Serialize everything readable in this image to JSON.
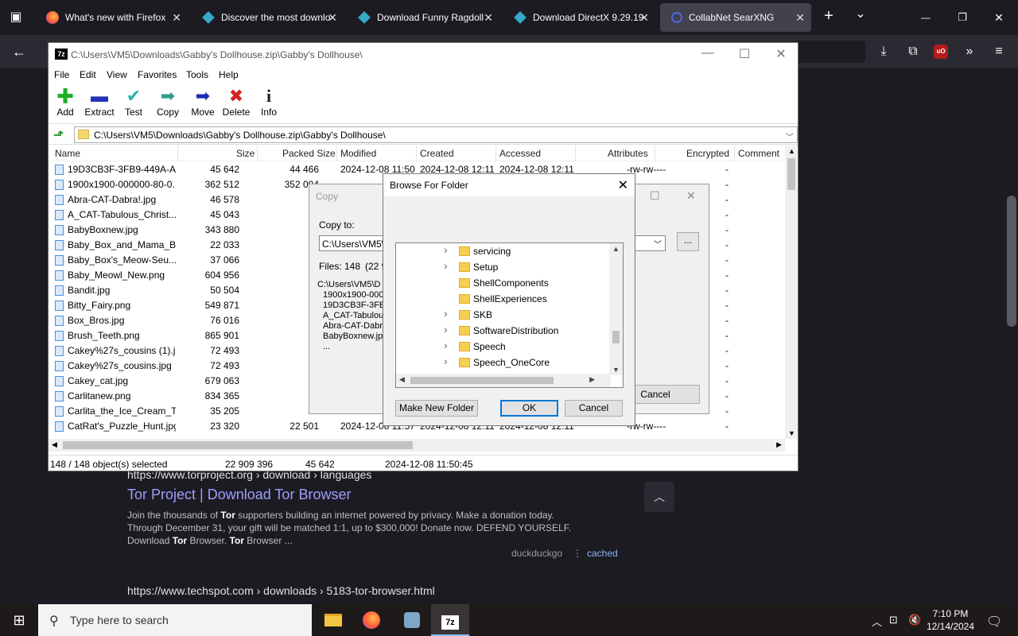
{
  "browser": {
    "tabs": [
      {
        "label": "What's new with Firefox",
        "icon": "firefox-icon"
      },
      {
        "label": "Discover the most downlo",
        "icon": "download-site-icon"
      },
      {
        "label": "Download Funny Ragdoll",
        "icon": "download-site-icon"
      },
      {
        "label": "Download DirectX 9.29.19",
        "icon": "download-site-icon"
      },
      {
        "label": "CollabNet SearXNG",
        "icon": "searxng-icon",
        "active": true
      }
    ],
    "new_tab": "+",
    "tab_list": "⌄",
    "minimize": "—",
    "restore": "❐",
    "close": "✕",
    "back": "←"
  },
  "search_results": [
    {
      "url": "https://www.torproject.org › download › languages",
      "title": "Tor Project | Download Tor Browser",
      "snippet_l1_a": "Join the thousands of ",
      "snippet_l1_b": "Tor",
      "snippet_l1_c": " supporters building an internet powered by privacy. Make a donation today.",
      "snippet_l2": "Through December 31, your gift will be matched 1:1, up to $300,000! Donate now. DEFEND YOURSELF.",
      "snippet_l3_a": "Download ",
      "snippet_l3_b": "Tor",
      "snippet_l3_c": " Browser. ",
      "snippet_l3_d": "Tor",
      "snippet_l3_e": " Browser ...",
      "engine": "duckduckgo",
      "sep": "⋮",
      "cached": "cached"
    },
    {
      "url": "https://www.techspot.com › downloads › 5183-tor-browser.html"
    }
  ],
  "sevenzip": {
    "title": "C:\\Users\\VM5\\Downloads\\Gabby's Dollhouse.zip\\Gabby's Dollhouse\\",
    "app_icon": "7z",
    "menu": [
      "File",
      "Edit",
      "View",
      "Favorites",
      "Tools",
      "Help"
    ],
    "toolbar": [
      "Add",
      "Extract",
      "Test",
      "Copy",
      "Move",
      "Delete",
      "Info"
    ],
    "address": "C:\\Users\\VM5\\Downloads\\Gabby's Dollhouse.zip\\Gabby's Dollhouse\\",
    "columns": [
      "Name",
      "Size",
      "Packed Size",
      "Modified",
      "Created",
      "Accessed",
      "Attributes",
      "Encrypted",
      "Comment"
    ],
    "rows": [
      {
        "name": "19D3CB3F-3FB9-449A-A...",
        "size": "45 642",
        "packed": "44 466",
        "modified": "2024-12-08 11:50",
        "created": "2024-12-08 12:11",
        "accessed": "2024-12-08 12:11",
        "attr": "-rw-rw----",
        "enc": "-"
      },
      {
        "name": "1900x1900-000000-80-0...",
        "size": "362 512",
        "packed": "352 004",
        "modified": "",
        "created": "",
        "accessed": "",
        "attr": "",
        "enc": "-"
      },
      {
        "name": "Abra-CAT-Dabra!.jpg",
        "size": "46 578",
        "packed": "4",
        "modified": "",
        "created": "",
        "accessed": "",
        "attr": "",
        "enc": "-"
      },
      {
        "name": "A_CAT-Tabulous_Christ...",
        "size": "45 043",
        "packed": "4",
        "modified": "",
        "created": "",
        "accessed": "",
        "attr": "",
        "enc": "-"
      },
      {
        "name": "BabyBoxnew.jpg",
        "size": "343 880",
        "packed": "33",
        "modified": "",
        "created": "",
        "accessed": "",
        "attr": "",
        "enc": "-"
      },
      {
        "name": "Baby_Box_and_Mama_B...",
        "size": "22 033",
        "packed": "2",
        "modified": "",
        "created": "",
        "accessed": "",
        "attr": "",
        "enc": "-"
      },
      {
        "name": "Baby_Box's_Meow-Seu...",
        "size": "37 066",
        "packed": "3",
        "modified": "",
        "created": "",
        "accessed": "",
        "attr": "",
        "enc": "-"
      },
      {
        "name": "Baby_Meowl_New.png",
        "size": "604 956",
        "packed": "60",
        "modified": "",
        "created": "",
        "accessed": "",
        "attr": "",
        "enc": "-"
      },
      {
        "name": "Bandit.jpg",
        "size": "50 504",
        "packed": "5",
        "modified": "",
        "created": "",
        "accessed": "",
        "attr": "",
        "enc": "-"
      },
      {
        "name": "Bitty_Fairy.png",
        "size": "549 871",
        "packed": "54",
        "modified": "",
        "created": "",
        "accessed": "",
        "attr": "",
        "enc": "-"
      },
      {
        "name": "Box_Bros.jpg",
        "size": "76 016",
        "packed": "7",
        "modified": "",
        "created": "",
        "accessed": "",
        "attr": "",
        "enc": "-"
      },
      {
        "name": "Brush_Teeth.png",
        "size": "865 901",
        "packed": "86",
        "modified": "",
        "created": "",
        "accessed": "",
        "attr": "",
        "enc": "-"
      },
      {
        "name": "Cakey%27s_cousins (1).j...",
        "size": "72 493",
        "packed": "7",
        "modified": "",
        "created": "",
        "accessed": "",
        "attr": "",
        "enc": "-"
      },
      {
        "name": "Cakey%27s_cousins.jpg",
        "size": "72 493",
        "packed": "7",
        "modified": "",
        "created": "",
        "accessed": "",
        "attr": "",
        "enc": "-"
      },
      {
        "name": "Cakey_cat.jpg",
        "size": "679 063",
        "packed": "63",
        "modified": "",
        "created": "",
        "accessed": "",
        "attr": "",
        "enc": "-"
      },
      {
        "name": "Carlitanew.png",
        "size": "834 365",
        "packed": "83",
        "modified": "",
        "created": "",
        "accessed": "",
        "attr": "",
        "enc": "-"
      },
      {
        "name": "Carlita_the_Ice_Cream_T...",
        "size": "35 205",
        "packed": "3",
        "modified": "",
        "created": "",
        "accessed": "",
        "attr": "",
        "enc": "-"
      },
      {
        "name": "CatRat's_Puzzle_Hunt.jpg",
        "size": "23 320",
        "packed": "22 501",
        "modified": "2024-12-08 11:57",
        "created": "2024-12-08 12:11",
        "accessed": "2024-12-08 12:11",
        "attr": "-rw-rw----",
        "enc": "-"
      }
    ],
    "status": {
      "selected": "148 / 148 object(s) selected",
      "total": "22 909 396",
      "sel_size": "45 642",
      "date": "2024-12-08 11:50:45"
    }
  },
  "copy_dialog": {
    "title": "Copy",
    "copy_to_label": "Copy to:",
    "path": "C:\\Users\\VM5\\D",
    "browse": "...",
    "files": "Files: 148",
    "files_size": "(22 9",
    "list": [
      "C:\\Users\\VM5\\D",
      "1900x1900-000",
      "19D3CB3F-3FB",
      "A_CAT-Tabulou",
      "Abra-CAT-Dabra",
      "BabyBoxnew.jpe",
      "..."
    ],
    "cancel": "Cancel"
  },
  "browse_dialog": {
    "title": "Browse For Folder",
    "close": "✕",
    "folders": [
      {
        "name": "servicing",
        "expandable": true
      },
      {
        "name": "Setup",
        "expandable": true
      },
      {
        "name": "ShellComponents",
        "expandable": false
      },
      {
        "name": "ShellExperiences",
        "expandable": false
      },
      {
        "name": "SKB",
        "expandable": true
      },
      {
        "name": "SoftwareDistribution",
        "expandable": true
      },
      {
        "name": "Speech",
        "expandable": true
      },
      {
        "name": "Speech_OneCore",
        "expandable": true
      }
    ],
    "make_new_folder": "Make New Folder",
    "ok": "OK",
    "cancel": "Cancel"
  },
  "taskbar": {
    "search_placeholder": "Type here to search",
    "time": "7:10 PM",
    "date": "12/14/2024"
  }
}
